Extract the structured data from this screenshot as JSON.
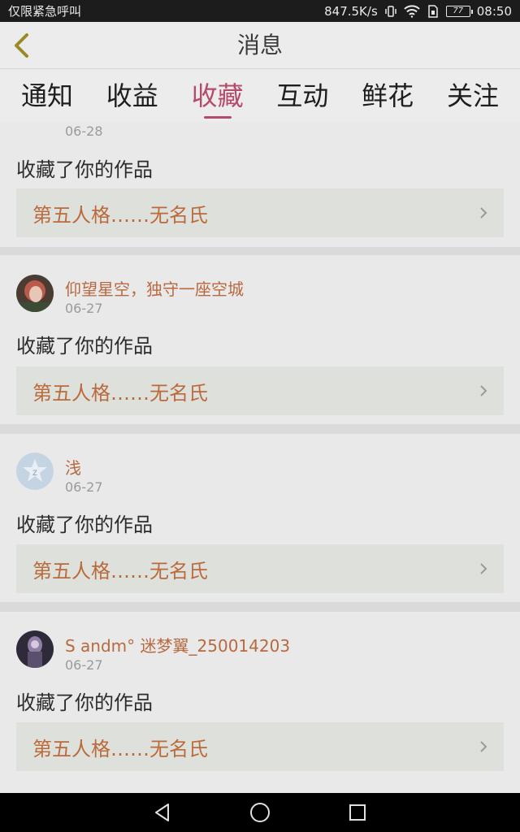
{
  "status_bar": {
    "carrier_text": "仅限紧急呼叫",
    "net_speed": "847.5K/s",
    "battery": "77",
    "time": "08:50"
  },
  "header": {
    "title": "消息"
  },
  "tabs": [
    {
      "label": "通知"
    },
    {
      "label": "收益"
    },
    {
      "label": "收藏"
    },
    {
      "label": "互动"
    },
    {
      "label": "鲜花"
    },
    {
      "label": "关注"
    }
  ],
  "notifications": [
    {
      "user": "",
      "date": "06-28",
      "action": "收藏了你的作品",
      "work": "第五人格……无名氏"
    },
    {
      "user": "仰望星空，独守一座空城",
      "date": "06-27",
      "action": "收藏了你的作品",
      "work": "第五人格……无名氏"
    },
    {
      "user": "浅",
      "date": "06-27",
      "action": "收藏了你的作品",
      "work": "第五人格……无名氏"
    },
    {
      "user": "S andm° 迷梦翼_250014203",
      "date": "06-27",
      "action": "收藏了你的作品",
      "work": "第五人格……无名氏"
    }
  ],
  "colors": {
    "accent": "#b44b6a",
    "name": "#b8693f"
  }
}
